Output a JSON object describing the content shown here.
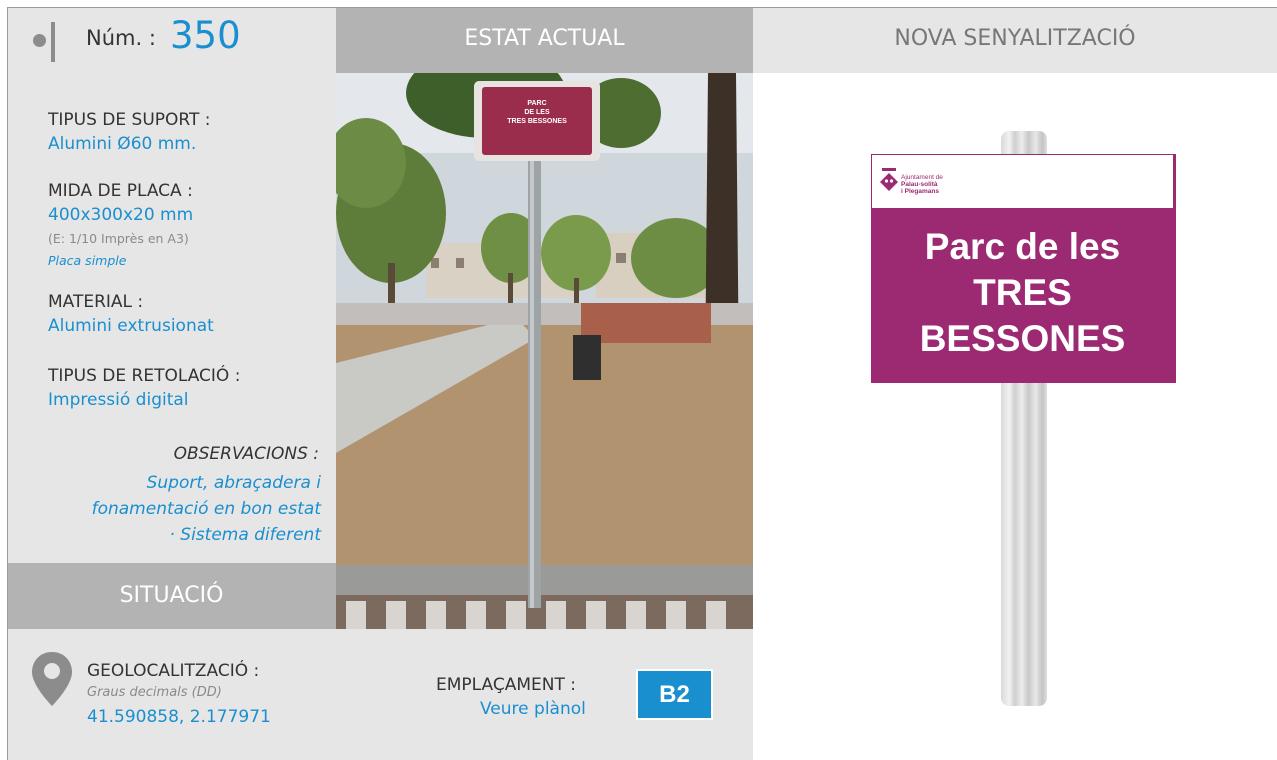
{
  "header": {
    "num_label": "Núm. :",
    "num_value": "350",
    "estat_label": "ESTAT ACTUAL",
    "nova_label": "NOVA SENYALITZACIÓ"
  },
  "specs": {
    "suport_label": "TIPUS DE SUPORT :",
    "suport_value": "Alumini Ø60 mm.",
    "mida_label": "MIDA DE PLACA :",
    "mida_value": "400x300x20 mm",
    "mida_scale": "(E: 1/10 Imprès en A3)",
    "mida_type": "Placa simple",
    "material_label": "MATERIAL :",
    "material_value": "Alumini extrusionat",
    "retolacio_label": "TIPUS DE RETOLACIÓ :",
    "retolacio_value": "Impressió digital",
    "obs_label": "OBSERVACIONS :",
    "obs_line1": "Suport, abraçadera i",
    "obs_line2": "fonamentació en bon estat",
    "obs_line3": "· Sistema diferent"
  },
  "situacio": {
    "label": "SITUACIÓ",
    "geo_label": "GEOLOCALITZACIÓ :",
    "geo_sub": "Graus decimals (DD)",
    "geo_value": "41.590858, 2.177971",
    "empl_label": "EMPLAÇAMENT :",
    "empl_link": "Veure plànol",
    "empl_badge": "B2"
  },
  "photo_sign": {
    "line1": "PARC",
    "line2": "DE LES",
    "line3": "TRES BESSONES"
  },
  "new_sign": {
    "logo_line1": "Ajuntament de",
    "logo_line2": "Palau-solità",
    "logo_line3": "i Plegamans",
    "line1": "Parc de les",
    "line2": "TRES",
    "line3": "BESSONES"
  },
  "colors": {
    "accent_blue": "#1a8fd0",
    "sign_magenta": "#9c2a73",
    "header_gray": "#b3b3b3",
    "panel_gray": "#e6e6e6"
  },
  "icons": {
    "location": "map-pin-icon",
    "bullet": "bullet-icon"
  }
}
